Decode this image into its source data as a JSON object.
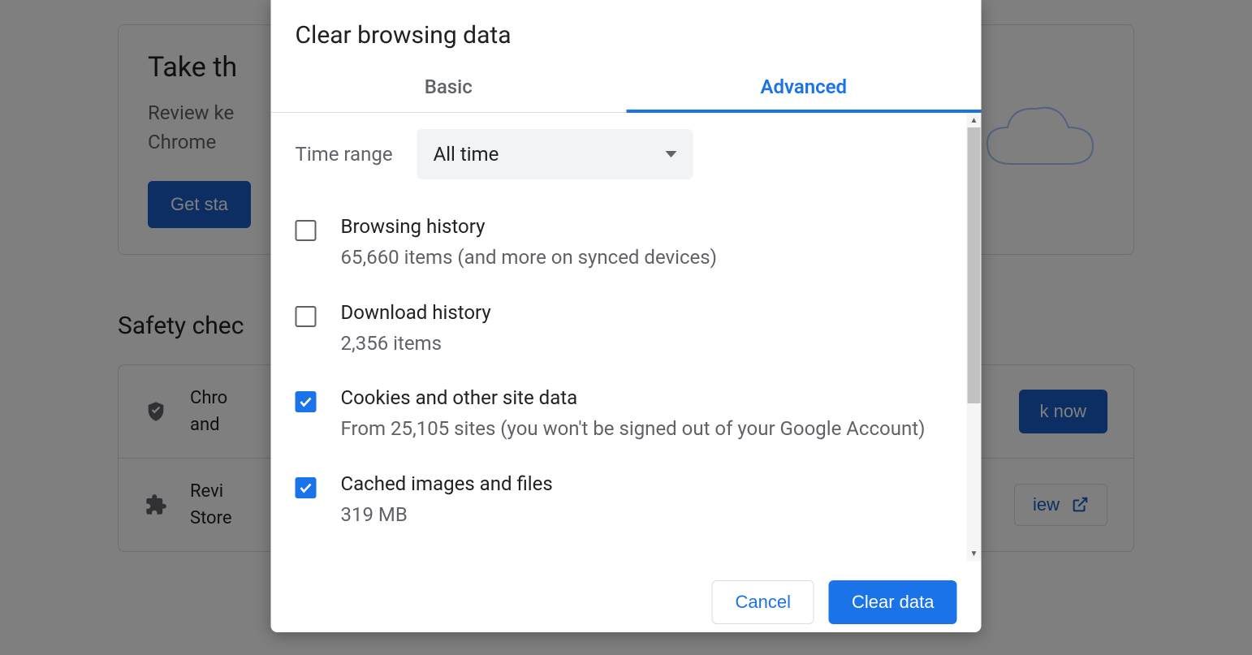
{
  "background": {
    "card_title": "Take th",
    "card_sub_line1": "Review ke",
    "card_sub_line2": "Chrome",
    "get_started_label": "Get sta",
    "safety_heading": "Safety chec",
    "row1_text": "Chro\nand",
    "row1_action": "k now",
    "row2_text": "Revi\nStore",
    "row2_action": "iew"
  },
  "dialog": {
    "title": "Clear browsing data",
    "tabs": {
      "basic": "Basic",
      "advanced": "Advanced"
    },
    "time_range_label": "Time range",
    "time_range_value": "All time",
    "items": [
      {
        "title": "Browsing history",
        "sub": "65,660 items (and more on synced devices)",
        "checked": false
      },
      {
        "title": "Download history",
        "sub": "2,356 items",
        "checked": false
      },
      {
        "title": "Cookies and other site data",
        "sub": "From 25,105 sites (you won't be signed out of your Google Account)",
        "checked": true
      },
      {
        "title": "Cached images and files",
        "sub": "319 MB",
        "checked": true
      }
    ],
    "cancel_label": "Cancel",
    "clear_label": "Clear data"
  }
}
